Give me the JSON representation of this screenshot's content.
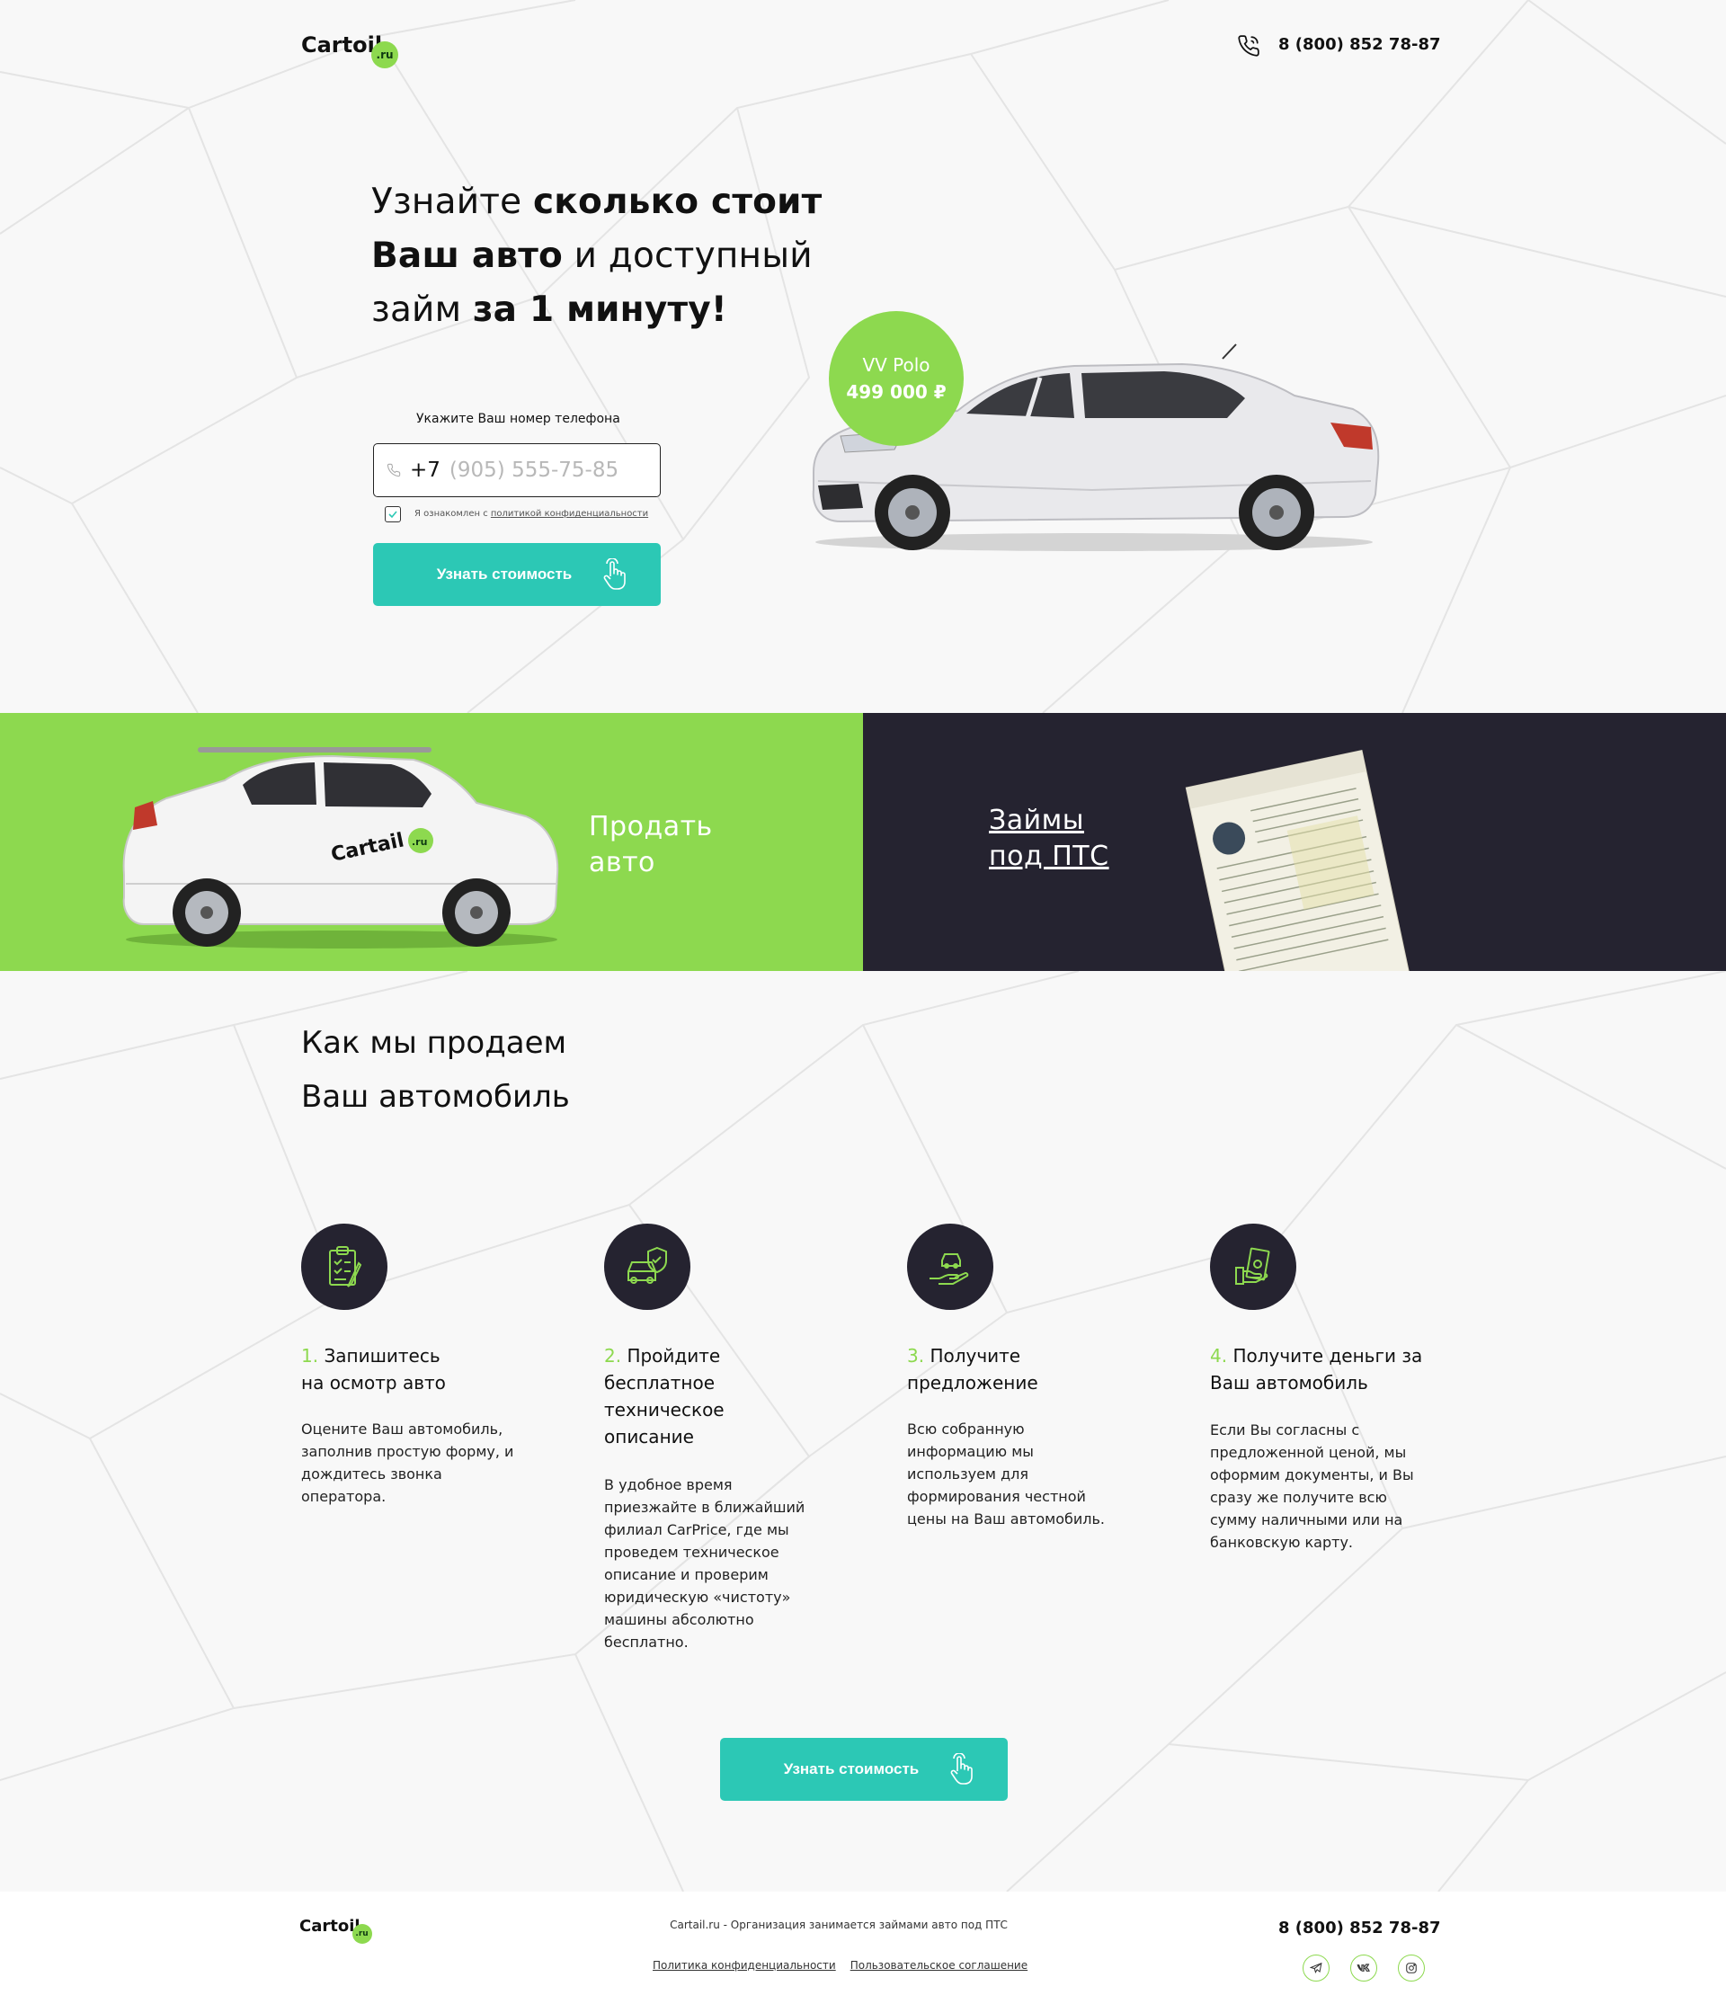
{
  "header": {
    "logo_text": "Cartoil",
    "logo_badge": ".ru",
    "phone": "8 (800) 852 78-87"
  },
  "hero": {
    "title_p1": "Узнайте ",
    "title_b1": "сколько стоит",
    "title_b2": "Ваш авто",
    "title_p2": " и доступный",
    "title_p3": "займ ",
    "title_b3": "за 1 минуту!",
    "phone_label": "Укажите Ваш номер телефона",
    "phone_prefix": "+7",
    "phone_placeholder": "(905) 555-75-85",
    "consent_text": "Я ознакомлен с ",
    "consent_link": "политикой конфиденциальности",
    "cta_label": "Узнать стоимость",
    "car_model": "VV Polo",
    "car_price": "499 000 ₽"
  },
  "split": {
    "sell_line1": "Продать",
    "sell_line2": "авто",
    "loans_line1": "Займы",
    "loans_line2": "под ПТС",
    "suv_logo_text": "Cartail",
    "suv_logo_badge": ".ru"
  },
  "how": {
    "title_line1": "Как мы продаем",
    "title_line2": "Ваш автомобиль",
    "steps": [
      {
        "num": "1.",
        "title_a": " Запишитесь",
        "title_b": "на осмотр авто",
        "desc": "Оцените Ваш автомобиль, заполнив простую форму, и дождитесь звонка оператора.",
        "icon": "clipboard-icon"
      },
      {
        "num": "2.",
        "title_a": " Пройдите",
        "title_b": "бесплатное техническое описание",
        "desc": "В удобное время приезжайте в ближайший филиал CarPrice, где мы проведем техническое описание и проверим юридическую «чистоту» машины абсолютно бесплатно.",
        "icon": "car-shield-icon"
      },
      {
        "num": "3.",
        "title_a": " Получите",
        "title_b": "предложение",
        "desc": "Всю собранную информацию мы используем для формирования честной цены на Ваш автомобиль.",
        "icon": "car-hand-icon"
      },
      {
        "num": "4.",
        "title_a": " Получите деньги за",
        "title_b": "Ваш автомобиль",
        "desc": "Если Вы согласны с предложенной ценой, мы оформим документы, и Вы сразу же получите всю сумму наличными или на банковскую карту.",
        "icon": "money-hand-icon"
      }
    ],
    "cta_label": "Узнать стоимость"
  },
  "footer": {
    "logo_text": "Cartoil",
    "logo_badge": ".ru",
    "description": "Cartail.ru - Организация занимается займами авто под ПТС",
    "link_privacy": "Политика конфиденциальности",
    "link_terms": "Пользовательское соглашение",
    "phone": "8 (800) 852 78-87",
    "social": [
      "telegram-icon",
      "vk-icon",
      "instagram-icon"
    ]
  },
  "colors": {
    "accent_green": "#8dd94f",
    "accent_teal": "#2cc8b5",
    "dark": "#252330",
    "background": "#f8f8f8"
  }
}
